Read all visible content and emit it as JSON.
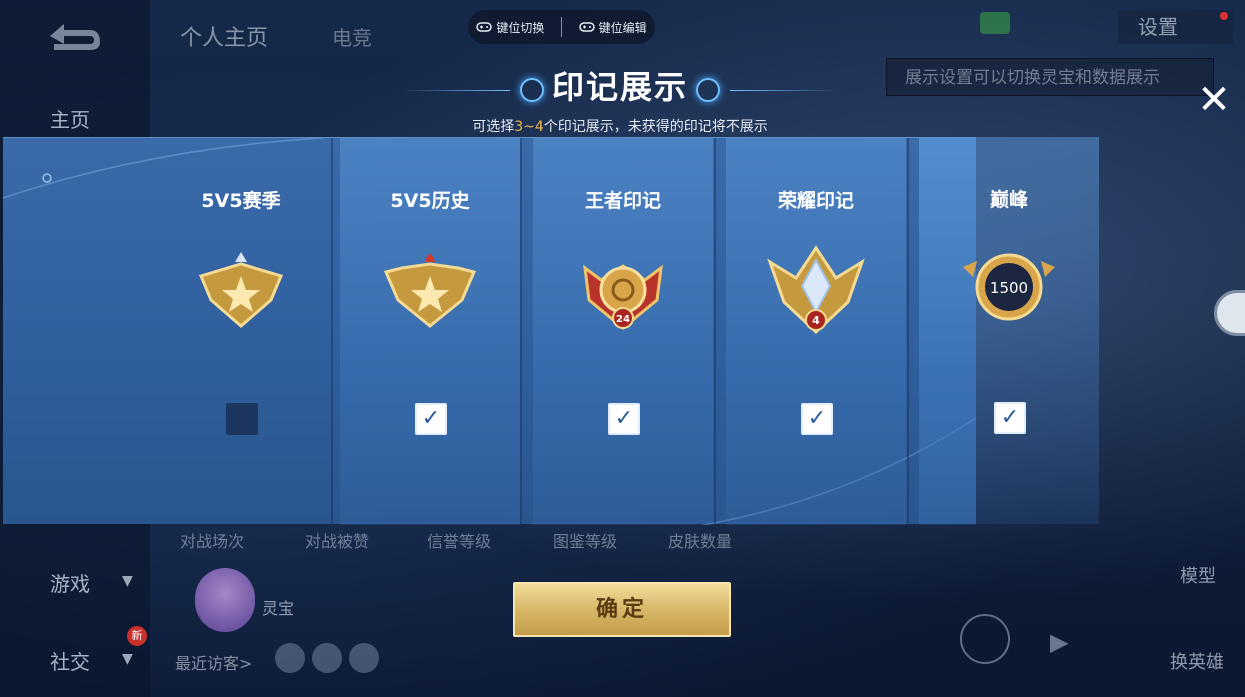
{
  "background": {
    "nav": {
      "home": "主页",
      "game": "游戏",
      "social": "社交",
      "new_badge": "新"
    },
    "top_tabs": {
      "profile": "个人主页",
      "esports": "电竞"
    },
    "settings": "设置",
    "hint": "展示设置可以切换灵宝和数据展示",
    "stats": [
      "对战场次",
      "对战被赞",
      "信誉等级",
      "图鉴等级",
      "皮肤数量"
    ],
    "lingbao": "灵宝",
    "recent_visitors": "最近访客>",
    "right_menu": {
      "model": "模型",
      "switch_hero": "换英雄"
    }
  },
  "keybar": {
    "switch": "键位切换",
    "edit": "键位编辑"
  },
  "modal": {
    "title": "印记展示",
    "subtitle_pre": "可选择",
    "subtitle_range": "3~4",
    "subtitle_post": "个印记展示，未获得的印记将不展示",
    "confirm": "确定",
    "close_glyph": "✕",
    "cards": [
      {
        "label": "5V5赛季",
        "checked": false,
        "badge_number": ""
      },
      {
        "label": "5V5历史",
        "checked": true,
        "badge_number": ""
      },
      {
        "label": "王者印记",
        "checked": true,
        "badge_number": "24"
      },
      {
        "label": "荣耀印记",
        "checked": true,
        "badge_number": "4"
      },
      {
        "label": "巅峰",
        "checked": true,
        "badge_number": "1500"
      }
    ],
    "check_glyph": "✓"
  },
  "colors": {
    "gold": "#d8b768",
    "highlight": "#f3b94c",
    "panel": "#3a6aaa"
  }
}
